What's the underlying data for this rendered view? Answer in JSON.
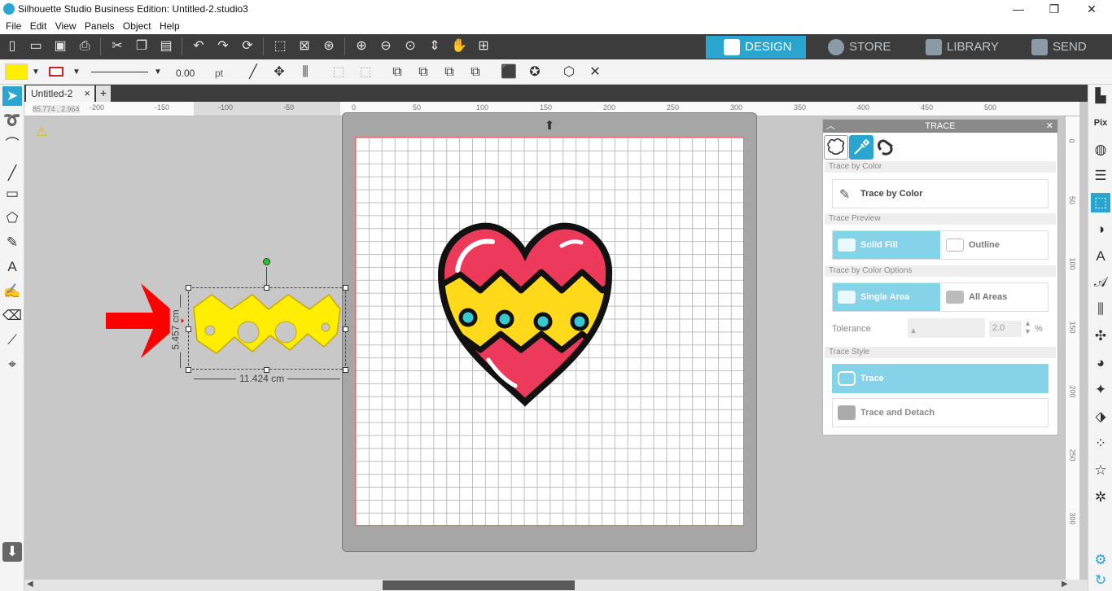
{
  "window": {
    "title": "Silhouette Studio Business Edition: Untitled-2.studio3",
    "min": "—",
    "max": "❐",
    "close": "✕"
  },
  "menu": [
    "File",
    "Edit",
    "View",
    "Panels",
    "Object",
    "Help"
  ],
  "mode_tabs": [
    {
      "label": "DESIGN",
      "icon": "grid-icon",
      "active": true
    },
    {
      "label": "STORE",
      "icon": "store-icon",
      "active": false
    },
    {
      "label": "LIBRARY",
      "icon": "library-icon",
      "active": false
    },
    {
      "label": "SEND",
      "icon": "send-icon",
      "active": false
    }
  ],
  "line_settings": {
    "width": "0.00",
    "unit": "pt"
  },
  "document_tab": {
    "label": "Untitled-2",
    "close": "×",
    "add": "+"
  },
  "coords": "85.774 , 2.964",
  "hruler_labels": [
    "-200",
    "-150",
    "-100",
    "-50",
    "0",
    "50",
    "100",
    "150",
    "200",
    "250",
    "300",
    "350",
    "400",
    "450",
    "500"
  ],
  "vruler_labels": [
    "0",
    "50",
    "100",
    "150",
    "200",
    "250",
    "300"
  ],
  "selection": {
    "width": "11.424 cm",
    "height": "5.457 cm"
  },
  "trace_panel": {
    "title": "TRACE",
    "sections": {
      "by_color": "Trace by Color",
      "preview": "Trace Preview",
      "options": "Trace by Color Options",
      "style": "Trace Style"
    },
    "trace_by_color_button": "Trace by Color",
    "preview_options": [
      "Solid Fill",
      "Outline"
    ],
    "area_options": [
      "Single Area",
      "All Areas"
    ],
    "tolerance": {
      "label": "Tolerance",
      "value": "2.0",
      "unit": "%"
    },
    "trace_button": "Trace",
    "trace_detach_button": "Trace and Detach"
  },
  "colors": {
    "accent": "#29a5cf",
    "fill_color": "#ffee00",
    "heart_red": "#ee3a5a",
    "arrow_red": "#ff0000"
  }
}
